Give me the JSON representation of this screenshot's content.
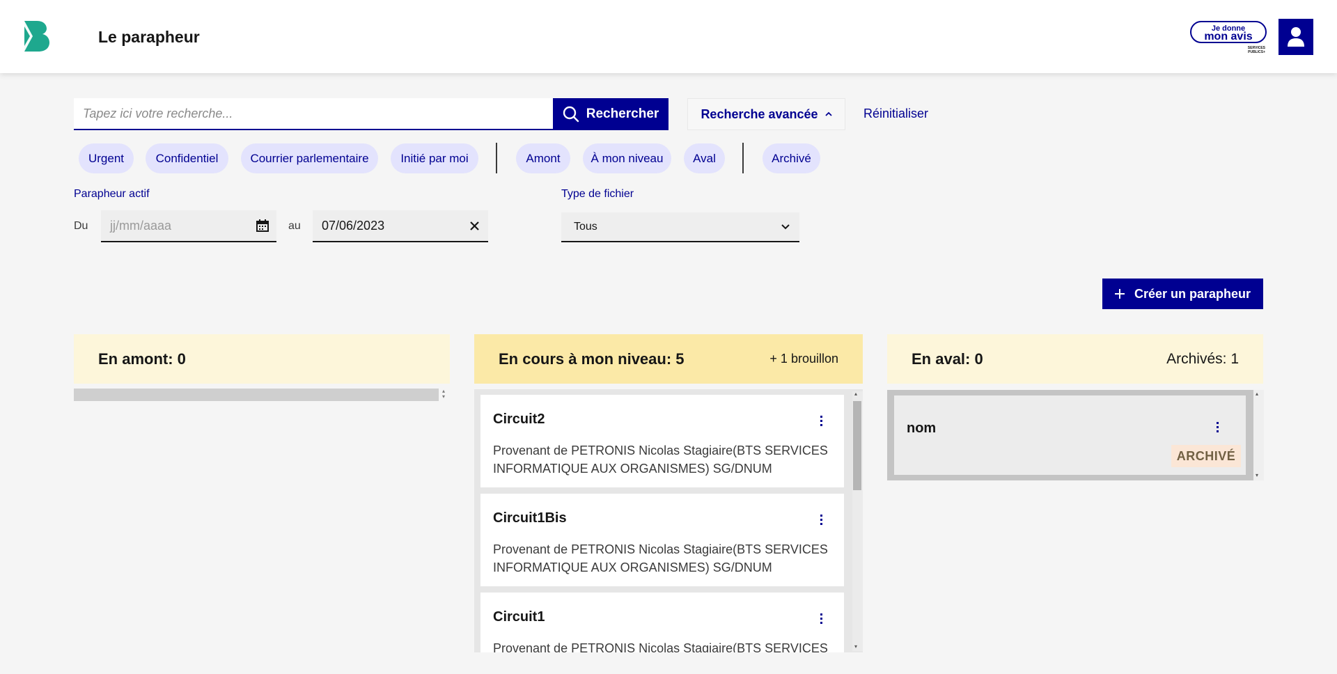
{
  "header": {
    "logo_icon": "b-letter-logo-icon",
    "app_title": "Le parapheur",
    "avis_top": "Je donne",
    "avis_bottom": "mon avis",
    "avis_small_line1": "SERVICES",
    "avis_small_line2": "PUBLICS+",
    "user_icon": "user-icon"
  },
  "search": {
    "placeholder": "Tapez ici votre recherche...",
    "value": "",
    "button_label": "Rechercher",
    "advanced_label": "Recherche avancée",
    "reset_label": "Réinitialiser"
  },
  "tags": {
    "group1": [
      "Urgent",
      "Confidentiel",
      "Courrier parlementaire",
      "Initié par moi"
    ],
    "group2": [
      "Amont",
      "À mon niveau",
      "Aval"
    ],
    "group3": [
      "Archivé"
    ]
  },
  "filters": {
    "active_label": "Parapheur actif",
    "from_label": "Du",
    "from_placeholder": "jj/mm/aaaa",
    "to_label": "au",
    "to_value": "07/06/2023",
    "file_type_label": "Type de fichier",
    "file_type_value": "Tous"
  },
  "create_button_label": "Créer un parapheur",
  "columns": {
    "amont": {
      "title": "En amont: 0"
    },
    "courant": {
      "title": "En cours à mon niveau: 5",
      "draft": "+ 1 brouillon",
      "cards": [
        {
          "title": "Circuit2",
          "desc": "Provenant de PETRONIS Nicolas Stagiaire(BTS SERVICES INFORMATIQUE AUX ORGANISMES) SG/DNUM"
        },
        {
          "title": "Circuit1Bis",
          "desc": "Provenant de PETRONIS Nicolas Stagiaire(BTS SERVICES INFORMATIQUE AUX ORGANISMES) SG/DNUM"
        },
        {
          "title": "Circuit1",
          "desc": "Provenant de PETRONIS Nicolas Stagiaire(BTS SERVICES INFORMATIQUE AUX ORGANISMES) SG/DNUM"
        }
      ]
    },
    "aval": {
      "title": "En aval: 0",
      "archived": "Archivés: 1",
      "card_title": "nom",
      "badge": "ARCHIVÉ"
    }
  },
  "colors": {
    "primary": "#000091",
    "tag_bg": "#e3e3fd",
    "amont_head_bg": "#fdf6da",
    "courant_head_bg": "#fbe9a7",
    "aval_head_bg": "#fdf6da",
    "badge_bg": "#fbe6d6",
    "logo": "#1ea88e"
  }
}
